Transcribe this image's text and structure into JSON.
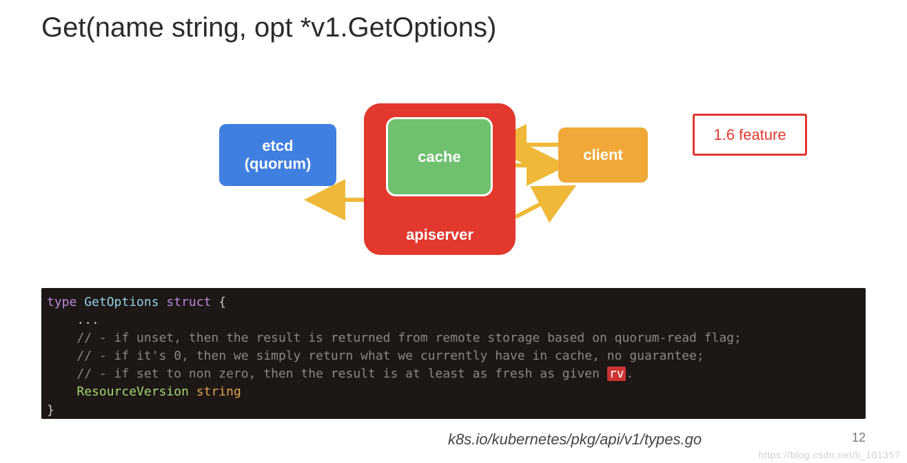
{
  "title": "Get(name string, opt *v1.GetOptions)",
  "diagram": {
    "etcd": "etcd\n(quorum)",
    "apiserver": "apiserver",
    "cache": "cache",
    "client": "client",
    "feature": "1.6 feature"
  },
  "code": {
    "kw_type": "type",
    "id_getoptions": "GetOptions",
    "kw_struct": "struct",
    "brace_open": "{",
    "ellipsis": "...",
    "c1": "// - if unset, then the result is returned from remote storage based on quorum-read flag;",
    "c2": "// - if it's 0, then we simply return what we currently have in cache, no guarantee;",
    "c3a": "// - if set to non zero, then the result is at least as fresh as given ",
    "c3_hl": "rv",
    "c3b": ".",
    "field": "ResourceVersion",
    "field_type": "string",
    "brace_close": "}"
  },
  "footer": {
    "path": "k8s.io/kubernetes/pkg/api/v1/types.go",
    "page": "12"
  },
  "watermark": "https://blog.csdn.net/li_101357"
}
